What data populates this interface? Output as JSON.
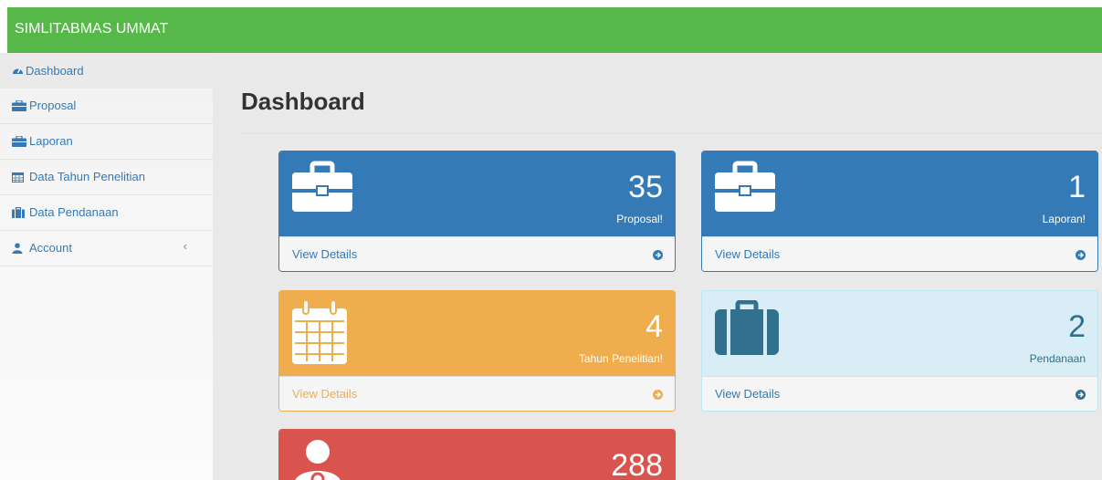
{
  "app": {
    "title": "SIMLITABMAS UMMAT"
  },
  "sidebar": {
    "items": [
      {
        "label": "Dashboard",
        "icon": "dashboard-icon"
      },
      {
        "label": "Proposal",
        "icon": "briefcase-icon"
      },
      {
        "label": "Laporan",
        "icon": "briefcase-icon"
      },
      {
        "label": "Data Tahun Penelitian",
        "icon": "calendar-icon"
      },
      {
        "label": "Data Pendanaan",
        "icon": "suitcase-icon"
      },
      {
        "label": "Account",
        "icon": "user-icon",
        "chevron": "‹"
      }
    ]
  },
  "main": {
    "title": "Dashboard",
    "panels": [
      {
        "count": "35",
        "label": "Proposal!",
        "link": "View Details",
        "icon": "briefcase-icon",
        "color": "#337ab7"
      },
      {
        "count": "1",
        "label": "Laporan!",
        "link": "View Details",
        "icon": "briefcase-icon",
        "color": "#337ab7"
      },
      {
        "count": "4",
        "label": "Tahun Penelitian!",
        "link": "View Details",
        "icon": "calendar-icon",
        "color": "#f0ad4e"
      },
      {
        "count": "2",
        "label": "Pendanaan",
        "link": "View Details",
        "icon": "suitcase-icon",
        "color": "#d9edf7"
      },
      {
        "count": "288",
        "icon": "user-md-icon",
        "color": "#d9534f"
      }
    ]
  },
  "colors": {
    "topbar": "#57b84a",
    "link": "#337ab7"
  }
}
